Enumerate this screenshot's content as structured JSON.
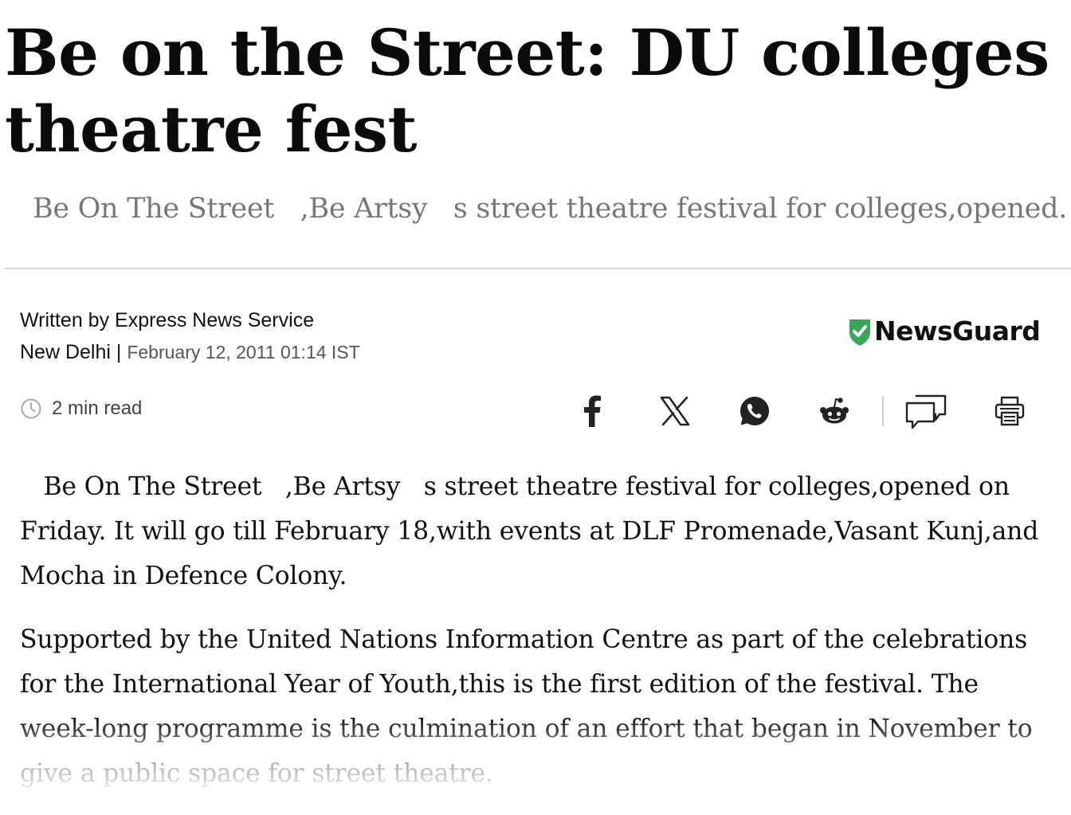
{
  "article": {
    "headline_line1": "Be on the Street: DU colleges f",
    "headline_line2": "theatre fest",
    "subhead_parts": [
      "Be On The Street",
      "   ,Be Artsy",
      "   s street theatre festival for colleges,opened."
    ],
    "byline_author": "Written by Express News Service",
    "byline_location": "New Delhi |",
    "byline_date": "February 12, 2011 01:14 IST",
    "read_time": "2 min read",
    "paragraphs": [
      "   Be On The Street   ,Be Artsy   s street theatre festival for colleges,opened on Friday. It will go till February 18,with events at DLF Promenade,Vasant Kunj,and Mocha in Defence Colony.",
      "Supported by the United Nations Information Centre as part of the celebrations for the International Year of Youth,this is the first edition of the festival. The week-long programme is the culmination of an effort that began in November to give a public space for street theatre."
    ]
  },
  "newsguard": {
    "label": "NewsGuard",
    "shield_color": "#3aa757"
  },
  "share_icons": [
    "facebook-icon",
    "x-icon",
    "whatsapp-icon",
    "reddit-icon",
    "comments-icon",
    "print-icon"
  ],
  "colors": {
    "icon": "#222222",
    "muted": "#777777"
  }
}
